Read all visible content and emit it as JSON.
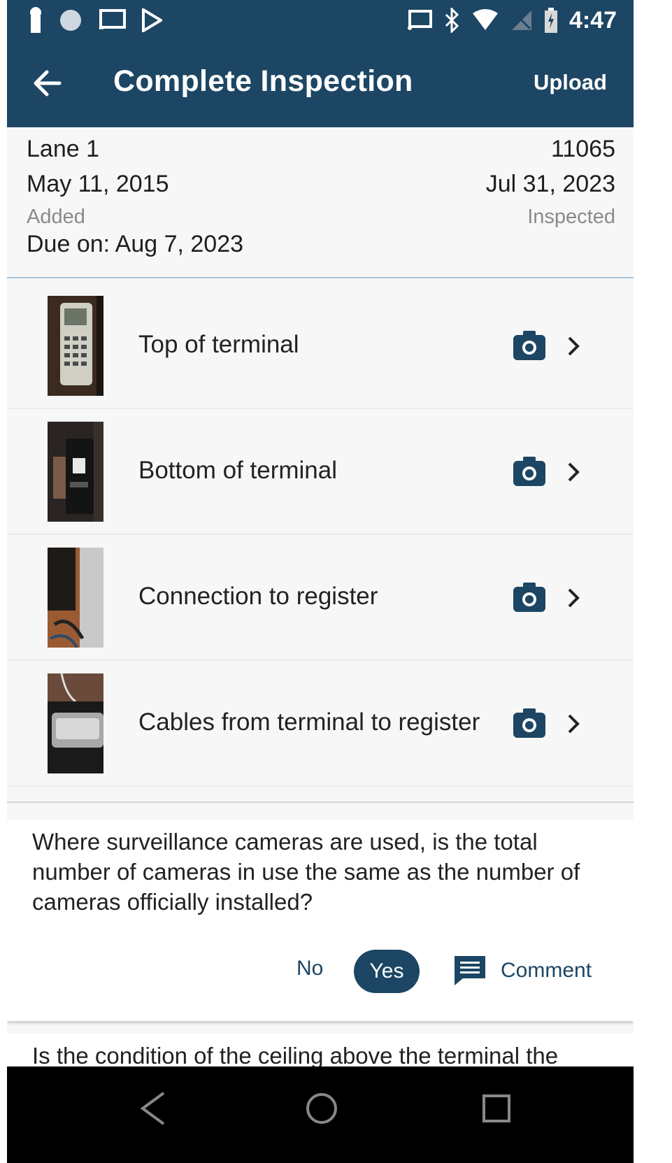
{
  "status_bar": {
    "time": "4:47",
    "icons": [
      "keyhole-icon",
      "globe-icon",
      "cast-icon",
      "play-store-icon",
      "cast-icon",
      "bluetooth-icon",
      "wifi-icon",
      "no-signal-icon",
      "battery-charging-icon"
    ]
  },
  "app_bar": {
    "title": "Complete Inspection",
    "action": "Upload",
    "back_icon": "arrow-left-icon",
    "color": "#1c4664"
  },
  "summary": {
    "lane": "Lane 1",
    "code": "11065",
    "added_date": "May 11, 2015",
    "added_label": "Added",
    "inspected_date": "Jul 31, 2023",
    "inspected_label": "Inspected",
    "due": "Due on: Aug 7, 2023"
  },
  "photos": [
    {
      "label": "Top of terminal"
    },
    {
      "label": "Bottom of terminal"
    },
    {
      "label": "Connection to register"
    },
    {
      "label": "Cables from terminal to register"
    }
  ],
  "questions": [
    {
      "text": "Where surveillance cameras are used, is the total number of cameras in use the same as the number of cameras officially installed?",
      "no_label": "No",
      "yes_label": "Yes",
      "comment_label": "Comment",
      "selected": "Yes"
    },
    {
      "text": "Is the condition of the ceiling above the terminal the"
    }
  ]
}
